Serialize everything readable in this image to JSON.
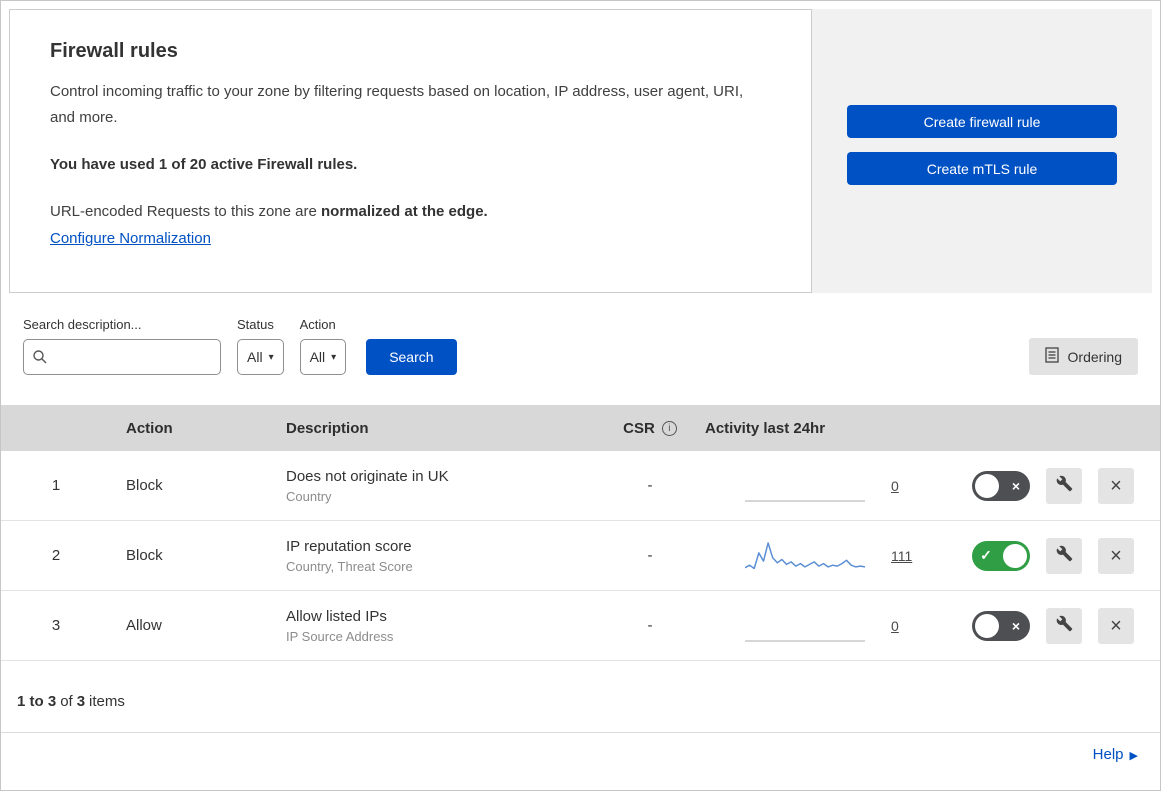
{
  "colors": {
    "accent_blue": "#0051c3",
    "toggle_on_green": "#2f9e44",
    "toggle_off_gray": "#4d4f53",
    "sparkline_blue": "#5b8fd4",
    "sparkline_flat_gray": "#c9c9c9",
    "table_header_gray": "#d8d8d8"
  },
  "icons": {
    "caret_down": "▾",
    "info": "i",
    "close": "×",
    "check": "✓",
    "help_arrow": "▶"
  },
  "header": {
    "title": "Firewall rules",
    "description": "Control incoming traffic to your zone by filtering requests based on location, IP address, user agent, URI, and more.",
    "usage_notice": "You have used 1 of 20 active Firewall rules.",
    "normalization_text": "URL-encoded Requests to this zone are ",
    "normalization_bold": "normalized at the edge.",
    "configure_link": "Configure Normalization",
    "create_firewall_button": "Create firewall rule",
    "create_mtls_button": "Create mTLS rule"
  },
  "filters": {
    "search_label": "Search description...",
    "status_label": "Status",
    "status_value": "All",
    "action_label": "Action",
    "action_value": "All",
    "search_button": "Search",
    "ordering_button": "Ordering"
  },
  "table": {
    "headers": {
      "action": "Action",
      "description": "Description",
      "csr": "CSR",
      "activity": "Activity last 24hr"
    },
    "rows": [
      {
        "num": "1",
        "action": "Block",
        "description": "Does not originate in UK",
        "fields": "Country",
        "csr": "-",
        "activity_count": "0",
        "enabled": false,
        "sparkline": [
          0,
          0,
          0,
          0,
          0,
          0,
          0,
          0,
          0,
          0
        ],
        "spark_color": "#c9c9c9"
      },
      {
        "num": "2",
        "action": "Block",
        "description": "IP reputation score",
        "fields": "Country, Threat Score",
        "csr": "-",
        "activity_count": "111",
        "enabled": true,
        "sparkline": [
          4,
          7,
          3,
          22,
          12,
          34,
          16,
          10,
          14,
          8,
          11,
          6,
          9,
          5,
          8,
          11,
          6,
          9,
          5,
          7,
          6,
          9,
          13,
          7,
          5,
          6,
          5
        ],
        "spark_color": "#5b8fd4"
      },
      {
        "num": "3",
        "action": "Allow",
        "description": "Allow listed IPs",
        "fields": "IP Source Address",
        "csr": "-",
        "activity_count": "0",
        "enabled": false,
        "sparkline": [
          0,
          0,
          0,
          0,
          0,
          0,
          0,
          0,
          0,
          0
        ],
        "spark_color": "#c9c9c9"
      }
    ]
  },
  "footer": {
    "range": "1 to 3",
    "of": "of",
    "total": "3",
    "items": "items",
    "help_link": "Help"
  }
}
